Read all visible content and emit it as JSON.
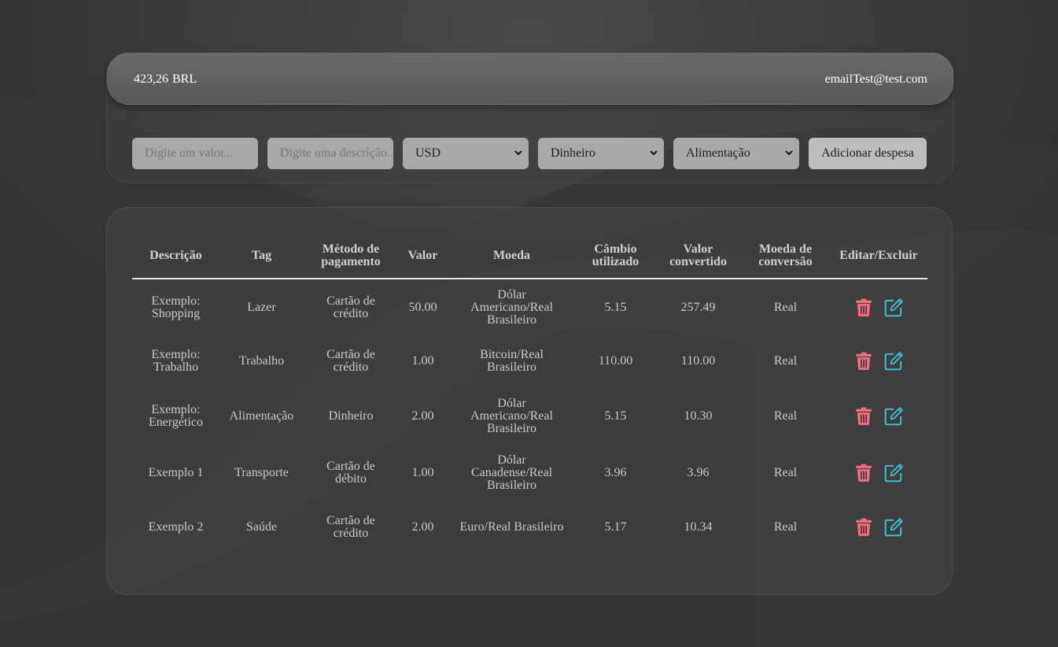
{
  "header": {
    "total_value": "423,26",
    "total_currency": "BRL",
    "email": "emailTest@test.com"
  },
  "form": {
    "value_placeholder": "Digite um valor...",
    "description_placeholder": "Digite uma descrição...",
    "currency_selected": "USD",
    "method_selected": "Dinheiro",
    "tag_selected": "Alimentação",
    "add_button_label": "Adicionar despesa"
  },
  "table": {
    "headers": [
      [
        "Descrição"
      ],
      [
        "Tag"
      ],
      [
        "Método de",
        "pagamento"
      ],
      [
        "Valor"
      ],
      [
        "Moeda"
      ],
      [
        "Câmbio",
        "utilizado"
      ],
      [
        "Valor",
        "convertido"
      ],
      [
        "Moeda de",
        "conversão"
      ],
      [
        "Editar/Excluir"
      ]
    ],
    "rows": [
      {
        "description": [
          "Exemplo:",
          "Shopping"
        ],
        "tag": [
          "Lazer"
        ],
        "method": [
          "Cartão de",
          "crédito"
        ],
        "value": [
          "50.00"
        ],
        "currency": [
          "Dólar",
          "Americano/Real",
          "Brasileiro"
        ],
        "rate": [
          "5.15"
        ],
        "converted": [
          "257.49"
        ],
        "conversion_currency": [
          "Real"
        ]
      },
      {
        "description": [
          "Exemplo:",
          "Trabalho"
        ],
        "tag": [
          "Trabalho"
        ],
        "method": [
          "Cartão de",
          "crédito"
        ],
        "value": [
          "1.00"
        ],
        "currency": [
          "Bitcoin/Real",
          "Brasileiro"
        ],
        "rate": [
          "110.00"
        ],
        "converted": [
          "110.00"
        ],
        "conversion_currency": [
          "Real"
        ]
      },
      {
        "description": [
          "Exemplo:",
          "Energético"
        ],
        "tag": [
          "Alimentação"
        ],
        "method": [
          "Dinheiro"
        ],
        "value": [
          "2.00"
        ],
        "currency": [
          "Dólar",
          "Americano/Real",
          "Brasileiro"
        ],
        "rate": [
          "5.15"
        ],
        "converted": [
          "10.30"
        ],
        "conversion_currency": [
          "Real"
        ]
      },
      {
        "description": [
          "Exemplo 1"
        ],
        "tag": [
          "Transporte"
        ],
        "method": [
          "Cartão de",
          "débito"
        ],
        "value": [
          "1.00"
        ],
        "currency": [
          "Dólar",
          "Canadense/Real",
          "Brasileiro"
        ],
        "rate": [
          "3.96"
        ],
        "converted": [
          "3.96"
        ],
        "conversion_currency": [
          "Real"
        ]
      },
      {
        "description": [
          "Exemplo 2"
        ],
        "tag": [
          "Saúde"
        ],
        "method": [
          "Cartão de",
          "crédito"
        ],
        "value": [
          "2.00"
        ],
        "currency": [
          "Euro/Real Brasileiro"
        ],
        "rate": [
          "5.17"
        ],
        "converted": [
          "10.34"
        ],
        "conversion_currency": [
          "Real"
        ]
      }
    ],
    "delete_icon": "trash-icon",
    "edit_icon": "edit-icon"
  },
  "colors": {
    "background": "#2f2f2f",
    "delete_icon": "#ff6b81",
    "edit_icon": "#3fc3dc",
    "table_text": "#c9c9c9"
  }
}
